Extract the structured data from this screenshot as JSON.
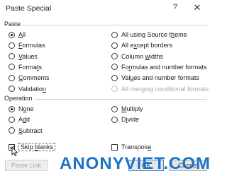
{
  "dialog": {
    "title": "Paste Special",
    "help_glyph": "?",
    "close_glyph": "✕"
  },
  "paste": {
    "heading": "Paste",
    "options": [
      {
        "label": "All",
        "hot": "A",
        "selected": true,
        "disabled": false
      },
      {
        "label": "Formulas",
        "hot": "F",
        "selected": false,
        "disabled": false
      },
      {
        "label": "Values",
        "hot": "V",
        "selected": false,
        "disabled": false
      },
      {
        "label": "Formats",
        "hot": "T",
        "selected": false,
        "disabled": false
      },
      {
        "label": "Comments",
        "hot": "C",
        "selected": false,
        "disabled": false
      },
      {
        "label": "Validation",
        "hot": "N",
        "selected": false,
        "disabled": false
      },
      {
        "label": "All using Source theme",
        "hot": "H",
        "selected": false,
        "disabled": false
      },
      {
        "label": "All except borders",
        "hot": "X",
        "selected": false,
        "disabled": false
      },
      {
        "label": "Column widths",
        "hot": "W",
        "selected": false,
        "disabled": false
      },
      {
        "label": "Formulas and number formats",
        "hot": "R",
        "selected": false,
        "disabled": false
      },
      {
        "label": "Values and number formats",
        "hot": "U",
        "selected": false,
        "disabled": false
      },
      {
        "label": "All merging conditional formats",
        "hot": "G",
        "selected": false,
        "disabled": true
      }
    ]
  },
  "operation": {
    "heading": "Operation",
    "options": [
      {
        "label": "None",
        "hot": "O",
        "selected": true
      },
      {
        "label": "Add",
        "hot": "D",
        "selected": false
      },
      {
        "label": "Subtract",
        "hot": "S",
        "selected": false
      },
      {
        "label": "Multiply",
        "hot": "M",
        "selected": false
      },
      {
        "label": "Divide",
        "hot": "I",
        "selected": false
      }
    ]
  },
  "checks": {
    "skip_blanks": {
      "label": "Skip blanks",
      "hot": "B",
      "checked": true
    },
    "transpose": {
      "label": "Transpose",
      "hot": "E",
      "checked": false
    }
  },
  "buttons": {
    "paste_link": "Paste Link",
    "ok": "OK",
    "cancel": "Cancel"
  },
  "watermark": "ANONYVIET.COM"
}
